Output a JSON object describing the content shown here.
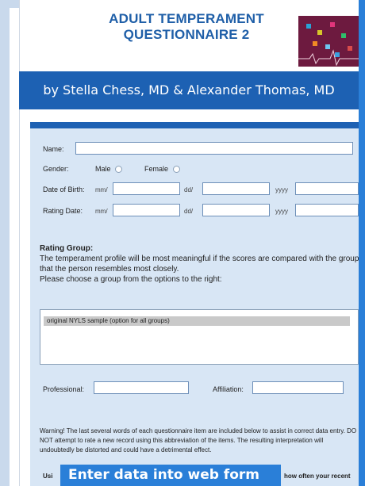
{
  "header": {
    "title_line1": "ADULT TEMPERAMENT",
    "title_line2": "QUESTIONNAIRE 2",
    "byline": "by Stella Chess, MD & Alexander Thomas, MD"
  },
  "form": {
    "name_label": "Name:",
    "name_value": "",
    "gender_label": "Gender:",
    "gender_options": [
      "Male",
      "Female"
    ],
    "dob_label": "Date of Birth:",
    "rating_date_label": "Rating Date:",
    "date_parts": [
      "mm/",
      "dd/",
      "yyyy"
    ],
    "rating_group_title": "Rating Group:",
    "rating_group_text": "The temperament profile will be most meaningful if the scores are compared with the group that the person resembles most closely.",
    "rating_group_instruction": "Please choose a group from the options to the right:",
    "group_options": [
      "original NYLS sample (option for all groups)"
    ],
    "professional_label": "Professional:",
    "affiliation_label": "Affiliation:",
    "warning_text": "Warning! The last several words of each questionnaire item are included below to assist in correct data entry. DO NOT attempt to rate a new record using this abbreviation of the items. The resulting interpretation will undoubtedly be distorted and could have a detrimental effect.",
    "partial_left": "Usi",
    "partial_right": "how often your recent"
  },
  "caption": "Enter data into web form",
  "colors": {
    "accent": "#1d61b3",
    "panel": "#d8e6f5",
    "caption_bg": "#2a7fd8"
  }
}
